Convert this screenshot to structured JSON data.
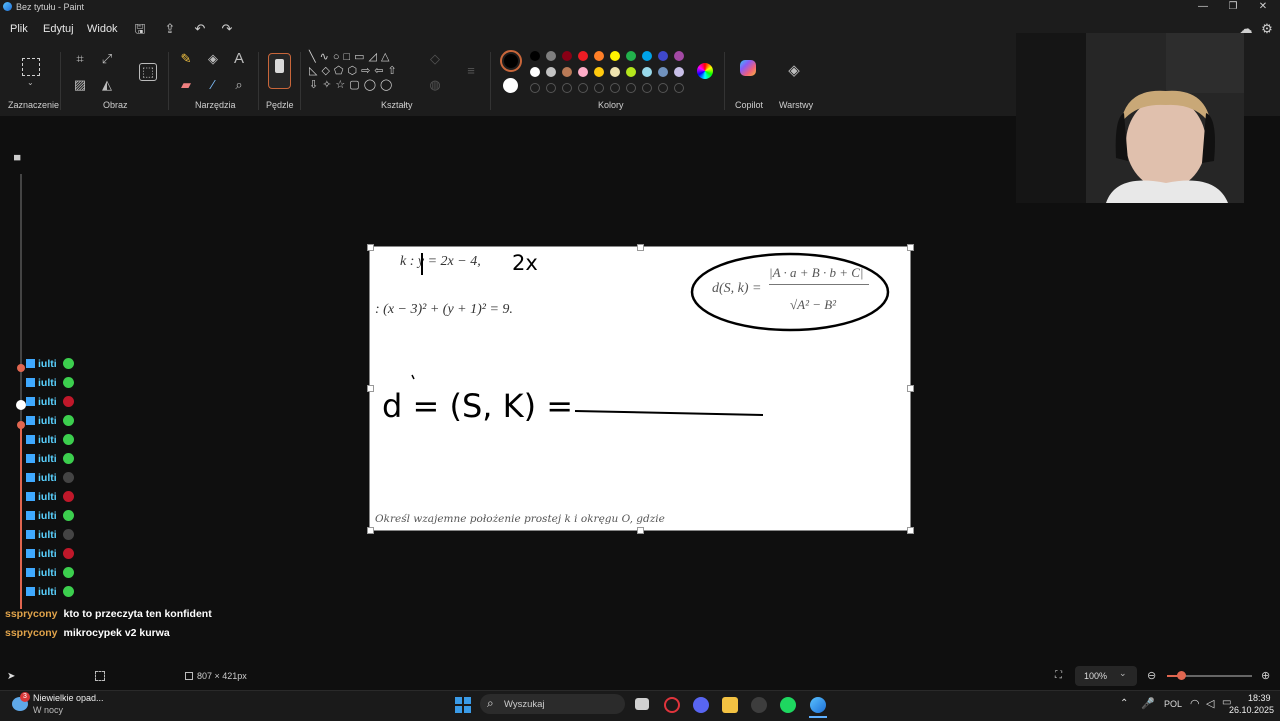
{
  "window": {
    "title": "Bez tytułu - Paint",
    "controls": [
      "—",
      "❐",
      "✕"
    ]
  },
  "menu": {
    "items": [
      "Plik",
      "Edytuj",
      "Widok"
    ]
  },
  "ribbon": {
    "groups": [
      "Zaznaczenie",
      "Obraz",
      "Narzędzia",
      "Pędzle",
      "Kształty",
      "Kolory",
      "Copilot",
      "Warstwy"
    ],
    "current_color": "#000000",
    "secondary_color": "#ffffff",
    "palette_row1": [
      "#000000",
      "#7f7f7f",
      "#880015",
      "#ed1c24",
      "#ff7f27",
      "#fff200",
      "#22b14c",
      "#00a2e8",
      "#3f48cc",
      "#a349a4"
    ],
    "palette_row2": [
      "#ffffff",
      "#c3c3c3",
      "#b97a57",
      "#ffaec9",
      "#ffc90e",
      "#efe4b0",
      "#b5e61d",
      "#99d9ea",
      "#7092be",
      "#c8bfe7"
    ]
  },
  "canvas": {
    "line_k": "k : y = 2x − 4,",
    "note_2x": "2x",
    "line_o": ": (x − 3)² + (y + 1)² = 9.",
    "formula_left": "d(S, k) =",
    "formula_num": "|A · a + B · b + C|",
    "formula_den": "√A² − B²",
    "handwritten_dist": "d = (S, K) =",
    "task_text": "Określ wzajemne położenie prostej k i okręgu O, gdzie"
  },
  "chat": {
    "repeat_user": "iulti",
    "repeat_count": 13,
    "messages": [
      {
        "user": "ssprycony",
        "text": "kto to przeczyta ten konfident"
      },
      {
        "user": "ssprycony",
        "text": "mikrocypek v2 kurwa"
      }
    ]
  },
  "statusbar": {
    "canvas_size": "807 × 421px",
    "zoom": "100%"
  },
  "taskbar": {
    "weather_title": "Niewielkie opad...",
    "weather_sub": "W nocy",
    "search_placeholder": "Wyszukaj",
    "lang": "POL",
    "time": "18:39",
    "date": "26.10.2025",
    "notification_badge": "3"
  }
}
